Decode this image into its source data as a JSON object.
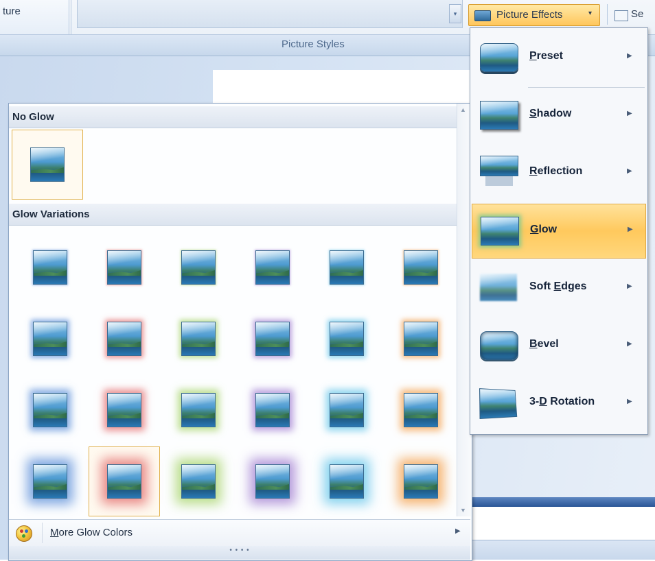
{
  "ribbon": {
    "left_fragment": "ture",
    "group_label": "Picture Styles",
    "effects_button_label": "Picture Effects",
    "select_button_label": "Se"
  },
  "glow_gallery": {
    "no_glow_header": "No Glow",
    "variations_header": "Glow Variations",
    "glow_colors": [
      "#5b8fd8",
      "#e46b6b",
      "#a7d46b",
      "#a27fd1",
      "#67c7ea",
      "#f4a04b"
    ],
    "glow_levels": [
      "5 pt",
      "8 pt",
      "11 pt",
      "18 pt"
    ],
    "selected": {
      "row": 3,
      "col": 1
    },
    "more_colors": {
      "mnemonic": "M",
      "rest": "ore Glow Colors"
    },
    "grip": "• • • •"
  },
  "effects_menu": {
    "items": [
      {
        "key": "preset",
        "mnemonic": "P",
        "rest": "reset",
        "pre": ""
      },
      {
        "key": "shadow",
        "mnemonic": "S",
        "rest": "hadow",
        "pre": ""
      },
      {
        "key": "reflection",
        "mnemonic": "R",
        "rest": "eflection",
        "pre": ""
      },
      {
        "key": "glow",
        "mnemonic": "G",
        "rest": "low",
        "pre": "",
        "active": true
      },
      {
        "key": "soft",
        "mnemonic": "E",
        "rest": "dges",
        "pre": "Soft "
      },
      {
        "key": "bevel",
        "mnemonic": "B",
        "rest": "evel",
        "pre": ""
      },
      {
        "key": "rotation",
        "mnemonic": "D",
        "rest": " Rotation",
        "pre": "3-"
      }
    ]
  },
  "icons": {
    "submenu": "submenu-arrow-icon",
    "dropdown": "dropdown-caret-icon",
    "palette": "color-palette-icon"
  }
}
